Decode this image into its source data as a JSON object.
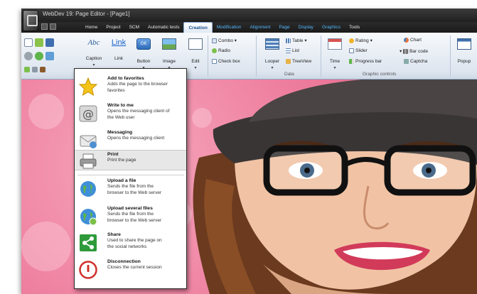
{
  "window": {
    "title": "WebDev 19: Page Editor - [Page1]"
  },
  "tabs": [
    {
      "label": "Home",
      "active": false
    },
    {
      "label": "Project",
      "active": false
    },
    {
      "label": "SCM",
      "active": false
    },
    {
      "label": "Automatic tests",
      "active": false
    },
    {
      "label": "Creation",
      "active": true
    },
    {
      "label": "Modification",
      "active": false
    },
    {
      "label": "Alignment",
      "active": false
    },
    {
      "label": "Page",
      "active": false
    },
    {
      "label": "Display",
      "active": false
    },
    {
      "label": "Graphics",
      "active": false
    },
    {
      "label": "Tools",
      "active": false
    }
  ],
  "ribbon": {
    "caption": {
      "label": "Caption",
      "glyph": "Abc"
    },
    "link": {
      "label": "Link",
      "glyph": "Link"
    },
    "button": {
      "label": "Button",
      "glyph": "OK"
    },
    "image": {
      "label": "Image"
    },
    "edit": {
      "label": "Edit"
    },
    "combo": "Combo",
    "radio": "Radio",
    "checkbox": "Check box",
    "looper": "Looper",
    "table": "Table",
    "list": "List",
    "treeview": "TreeView",
    "data_group": "Data",
    "time": "Time",
    "rating": "Rating",
    "slider": "Slider",
    "progress": "Progress bar",
    "chart": "Chart",
    "barcode": "Bar code",
    "captcha": "Captcha",
    "graphic_group": "Graphic controls",
    "popup": "Popup"
  },
  "menu": {
    "items": [
      {
        "title": "Add to favorites",
        "desc": [
          "Adds the page to the browser",
          "favorites"
        ],
        "icon": "star-icon"
      },
      {
        "title": "Write to me",
        "desc": [
          "Opens the messaging client of",
          "the Web user"
        ],
        "icon": "at-sign-icon"
      },
      {
        "title": "Messaging",
        "desc": [
          "Opens the messaging client"
        ],
        "icon": "mail-icon"
      },
      {
        "title": "Print",
        "desc": [
          "Print the page"
        ],
        "icon": "printer-icon",
        "highlighted": true
      },
      {
        "title": "Upload a file",
        "desc": [
          "Sends the file from the",
          "browser to the Web server"
        ],
        "icon": "globe-upload-icon"
      },
      {
        "title": "Upload several files",
        "desc": [
          "Sends the file from the",
          "browser to the Web server"
        ],
        "icon": "globe-upload-multi-icon"
      },
      {
        "title": "Share",
        "desc": [
          "Used to share the page on",
          "the social networks"
        ],
        "icon": "share-icon"
      },
      {
        "title": "Disconnection",
        "desc": [
          "Closes the current session"
        ],
        "icon": "power-icon"
      }
    ]
  },
  "colors": {
    "accent_tab": "#53b7ff",
    "active_tab_text": "#1d4e89",
    "background_pink": "#ee7f9f",
    "hat": "#3a3535",
    "glasses": "#111111"
  }
}
